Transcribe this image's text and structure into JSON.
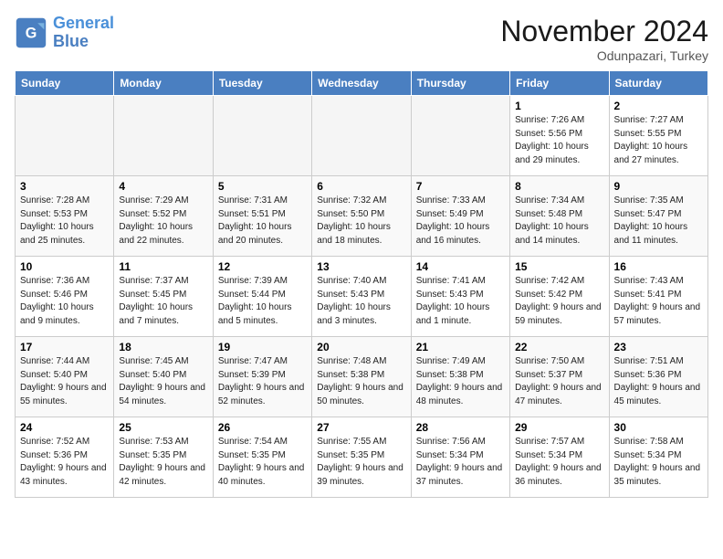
{
  "logo": {
    "line1": "General",
    "line2": "Blue"
  },
  "title": "November 2024",
  "location": "Odunpazari, Turkey",
  "weekdays": [
    "Sunday",
    "Monday",
    "Tuesday",
    "Wednesday",
    "Thursday",
    "Friday",
    "Saturday"
  ],
  "weeks": [
    [
      {
        "day": "",
        "info": ""
      },
      {
        "day": "",
        "info": ""
      },
      {
        "day": "",
        "info": ""
      },
      {
        "day": "",
        "info": ""
      },
      {
        "day": "",
        "info": ""
      },
      {
        "day": "1",
        "info": "Sunrise: 7:26 AM\nSunset: 5:56 PM\nDaylight: 10 hours\nand 29 minutes."
      },
      {
        "day": "2",
        "info": "Sunrise: 7:27 AM\nSunset: 5:55 PM\nDaylight: 10 hours\nand 27 minutes."
      }
    ],
    [
      {
        "day": "3",
        "info": "Sunrise: 7:28 AM\nSunset: 5:53 PM\nDaylight: 10 hours\nand 25 minutes."
      },
      {
        "day": "4",
        "info": "Sunrise: 7:29 AM\nSunset: 5:52 PM\nDaylight: 10 hours\nand 22 minutes."
      },
      {
        "day": "5",
        "info": "Sunrise: 7:31 AM\nSunset: 5:51 PM\nDaylight: 10 hours\nand 20 minutes."
      },
      {
        "day": "6",
        "info": "Sunrise: 7:32 AM\nSunset: 5:50 PM\nDaylight: 10 hours\nand 18 minutes."
      },
      {
        "day": "7",
        "info": "Sunrise: 7:33 AM\nSunset: 5:49 PM\nDaylight: 10 hours\nand 16 minutes."
      },
      {
        "day": "8",
        "info": "Sunrise: 7:34 AM\nSunset: 5:48 PM\nDaylight: 10 hours\nand 14 minutes."
      },
      {
        "day": "9",
        "info": "Sunrise: 7:35 AM\nSunset: 5:47 PM\nDaylight: 10 hours\nand 11 minutes."
      }
    ],
    [
      {
        "day": "10",
        "info": "Sunrise: 7:36 AM\nSunset: 5:46 PM\nDaylight: 10 hours\nand 9 minutes."
      },
      {
        "day": "11",
        "info": "Sunrise: 7:37 AM\nSunset: 5:45 PM\nDaylight: 10 hours\nand 7 minutes."
      },
      {
        "day": "12",
        "info": "Sunrise: 7:39 AM\nSunset: 5:44 PM\nDaylight: 10 hours\nand 5 minutes."
      },
      {
        "day": "13",
        "info": "Sunrise: 7:40 AM\nSunset: 5:43 PM\nDaylight: 10 hours\nand 3 minutes."
      },
      {
        "day": "14",
        "info": "Sunrise: 7:41 AM\nSunset: 5:43 PM\nDaylight: 10 hours\nand 1 minute."
      },
      {
        "day": "15",
        "info": "Sunrise: 7:42 AM\nSunset: 5:42 PM\nDaylight: 9 hours\nand 59 minutes."
      },
      {
        "day": "16",
        "info": "Sunrise: 7:43 AM\nSunset: 5:41 PM\nDaylight: 9 hours\nand 57 minutes."
      }
    ],
    [
      {
        "day": "17",
        "info": "Sunrise: 7:44 AM\nSunset: 5:40 PM\nDaylight: 9 hours\nand 55 minutes."
      },
      {
        "day": "18",
        "info": "Sunrise: 7:45 AM\nSunset: 5:40 PM\nDaylight: 9 hours\nand 54 minutes."
      },
      {
        "day": "19",
        "info": "Sunrise: 7:47 AM\nSunset: 5:39 PM\nDaylight: 9 hours\nand 52 minutes."
      },
      {
        "day": "20",
        "info": "Sunrise: 7:48 AM\nSunset: 5:38 PM\nDaylight: 9 hours\nand 50 minutes."
      },
      {
        "day": "21",
        "info": "Sunrise: 7:49 AM\nSunset: 5:38 PM\nDaylight: 9 hours\nand 48 minutes."
      },
      {
        "day": "22",
        "info": "Sunrise: 7:50 AM\nSunset: 5:37 PM\nDaylight: 9 hours\nand 47 minutes."
      },
      {
        "day": "23",
        "info": "Sunrise: 7:51 AM\nSunset: 5:36 PM\nDaylight: 9 hours\nand 45 minutes."
      }
    ],
    [
      {
        "day": "24",
        "info": "Sunrise: 7:52 AM\nSunset: 5:36 PM\nDaylight: 9 hours\nand 43 minutes."
      },
      {
        "day": "25",
        "info": "Sunrise: 7:53 AM\nSunset: 5:35 PM\nDaylight: 9 hours\nand 42 minutes."
      },
      {
        "day": "26",
        "info": "Sunrise: 7:54 AM\nSunset: 5:35 PM\nDaylight: 9 hours\nand 40 minutes."
      },
      {
        "day": "27",
        "info": "Sunrise: 7:55 AM\nSunset: 5:35 PM\nDaylight: 9 hours\nand 39 minutes."
      },
      {
        "day": "28",
        "info": "Sunrise: 7:56 AM\nSunset: 5:34 PM\nDaylight: 9 hours\nand 37 minutes."
      },
      {
        "day": "29",
        "info": "Sunrise: 7:57 AM\nSunset: 5:34 PM\nDaylight: 9 hours\nand 36 minutes."
      },
      {
        "day": "30",
        "info": "Sunrise: 7:58 AM\nSunset: 5:34 PM\nDaylight: 9 hours\nand 35 minutes."
      }
    ]
  ]
}
